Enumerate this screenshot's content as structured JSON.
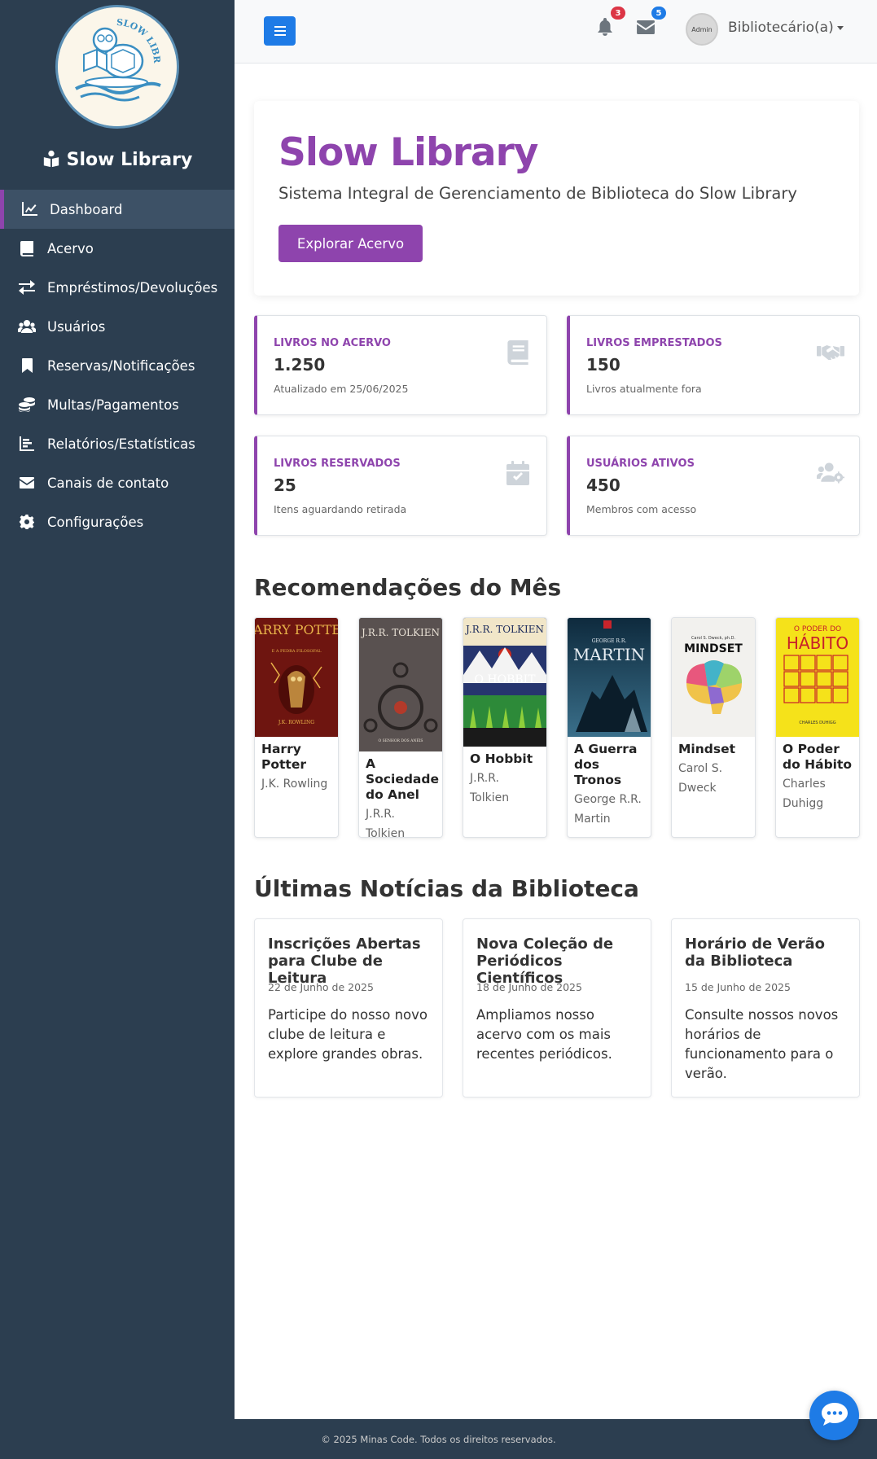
{
  "sidebar": {
    "brand": "Slow Library",
    "logo_text": "SLOW LIBRARY",
    "items": [
      {
        "label": "Dashboard",
        "icon": "chart-line-icon",
        "active": true
      },
      {
        "label": "Acervo",
        "icon": "book-icon"
      },
      {
        "label": "Empréstimos/Devoluções",
        "icon": "exchange-icon"
      },
      {
        "label": "Usuários",
        "icon": "users-icon"
      },
      {
        "label": "Reservas/Notificações",
        "icon": "bookmark-icon"
      },
      {
        "label": "Multas/Pagamentos",
        "icon": "coins-icon"
      },
      {
        "label": "Relatórios/Estatísticas",
        "icon": "bar-chart-icon"
      },
      {
        "label": "Canais de contato",
        "icon": "envelope-icon"
      },
      {
        "label": "Configurações",
        "icon": "gear-icon"
      }
    ]
  },
  "topbar": {
    "notifications_count": "3",
    "messages_count": "5",
    "avatar_text": "Admin",
    "user_name": "Bibliotecário(a)"
  },
  "hero": {
    "title": "Slow Library",
    "subtitle": "Sistema Integral de Gerenciamento de Biblioteca do Slow Library",
    "button": "Explorar Acervo"
  },
  "stats": [
    {
      "label": "LIVROS NO ACERVO",
      "value": "1.250",
      "desc": "Atualizado em 25/06/2025",
      "icon": "book-icon"
    },
    {
      "label": "LIVROS EMPRESTADOS",
      "value": "150",
      "desc": "Livros atualmente fora",
      "icon": "handshake-icon"
    },
    {
      "label": "LIVROS RESERVADOS",
      "value": "25",
      "desc": "Itens aguardando retirada",
      "icon": "calendar-check-icon"
    },
    {
      "label": "USUÁRIOS ATIVOS",
      "value": "450",
      "desc": "Membros com acesso",
      "icon": "users-gear-icon"
    }
  ],
  "recommendations": {
    "title": "Recomendações do Mês",
    "books": [
      {
        "title": "Harry Potter",
        "author": "J.K. Rowling",
        "cover_top": "HARRY POTTER",
        "cover_sub": "E A PEDRA FILOSOFAL",
        "cover_author": "J.K. ROWLING"
      },
      {
        "title": "A Sociedade do Anel",
        "author": "J.R.R. Tolkien",
        "cover_top": "J.R.R. TOLKIEN",
        "cover_sub": "O SENHOR DOS ANÉIS"
      },
      {
        "title": "O Hobbit",
        "author": "J.R.R. Tolkien",
        "cover_top": "J.R.R. TOLKIEN",
        "cover_sub": "O HOBBIT"
      },
      {
        "title": "A Guerra dos Tronos",
        "author": "George R.R. Martin",
        "cover_top": "GEORGE R.R.",
        "cover_sub": "MARTIN"
      },
      {
        "title": "Mindset",
        "author": "Carol S. Dweck",
        "cover_top": "Carol S. Dweck, ph.D.",
        "cover_sub": "MINDSET"
      },
      {
        "title": "O Poder do Hábito",
        "author": "Charles Duhigg",
        "cover_top": "O PODER DO",
        "cover_sub": "HÁBITO",
        "cover_author": "CHARLES DUHIGG"
      }
    ]
  },
  "news": {
    "title": "Últimas Notícias da Biblioteca",
    "items": [
      {
        "title": "Inscrições Abertas para Clube de Leitura",
        "date": "22 de Junho de 2025",
        "text": "Participe do nosso novo clube de leitura e explore grandes obras."
      },
      {
        "title": "Nova Coleção de Periódicos Científicos",
        "date": "18 de Junho de 2025",
        "text": "Ampliamos nosso acervo com os mais recentes periódicos."
      },
      {
        "title": "Horário de Verão da Biblioteca",
        "date": "15 de Junho de 2025",
        "text": "Consulte nossos novos horários de funcionamento para o verão."
      }
    ]
  },
  "footer": {
    "text": "© 2025 Minas Code. Todos os direitos reservados."
  },
  "colors": {
    "sidebar": "#2c3e50",
    "accent": "#8e44ad",
    "primary": "#1e7be6",
    "danger": "#dc3545"
  }
}
